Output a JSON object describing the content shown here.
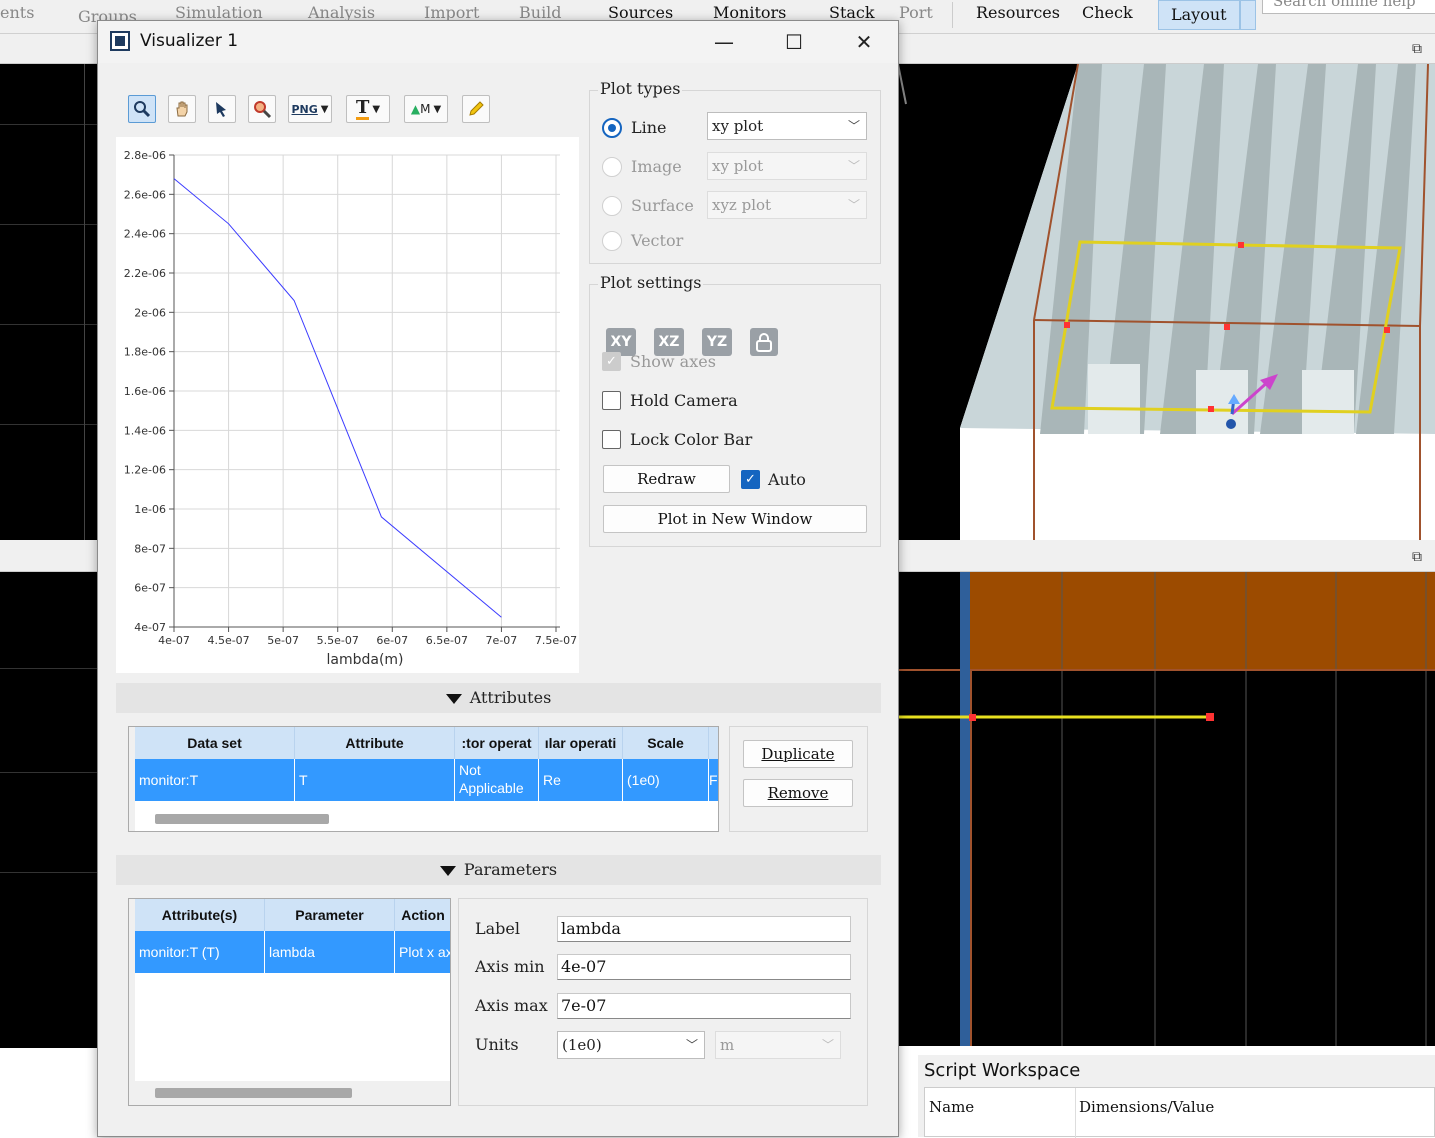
{
  "menu": {
    "items": [
      {
        "label": "ents",
        "dim": true
      },
      {
        "label": "Groups",
        "dim": true
      },
      {
        "label": "Simulation",
        "dim": true
      },
      {
        "label": "Analysis",
        "dim": true
      },
      {
        "label": "Import",
        "dim": true
      },
      {
        "label": "Build",
        "dim": true
      },
      {
        "label": "Sources",
        "dim": false
      },
      {
        "label": "Monitors",
        "dim": false
      },
      {
        "label": "Stack",
        "dim": false
      },
      {
        "label": "Port",
        "dim": true
      },
      {
        "label": "Resources",
        "dim": false
      },
      {
        "label": "Check",
        "dim": false
      },
      {
        "label": "Layout",
        "dim": false
      }
    ],
    "search_placeholder": "Search online help"
  },
  "script_workspace": {
    "title": "Script Workspace",
    "columns": [
      "Name",
      "Dimensions/Value"
    ]
  },
  "visualizer": {
    "title": "Visualizer 1",
    "window_controls": {
      "minimize": "—",
      "maximize": "☐",
      "close": "✕"
    },
    "toolbar": {
      "png_label": "PNG",
      "text_label": "T",
      "marker_label": "M"
    },
    "plot_types": {
      "title": "Plot types",
      "options": [
        {
          "label": "Line",
          "selected": true,
          "enabled": true,
          "combo": "xy plot"
        },
        {
          "label": "Image",
          "selected": false,
          "enabled": false,
          "combo": "xy plot"
        },
        {
          "label": "Surface",
          "selected": false,
          "enabled": false,
          "combo": "xyz plot"
        },
        {
          "label": "Vector",
          "selected": false,
          "enabled": false,
          "combo": ""
        }
      ]
    },
    "plot_settings": {
      "title": "Plot settings",
      "view_buttons": [
        "XY",
        "XZ",
        "YZ"
      ],
      "show_axes": {
        "label": "Show axes",
        "checked": true,
        "enabled": false
      },
      "hold_camera": {
        "label": "Hold Camera",
        "checked": false
      },
      "lock_color_bar": {
        "label": "Lock Color Bar",
        "checked": false
      },
      "redraw_label": "Redraw",
      "auto": {
        "label": "Auto",
        "checked": true
      },
      "plot_new_window_label": "Plot in New Window"
    },
    "attributes": {
      "header": "Attributes",
      "columns": [
        "Data set",
        "Attribute",
        ":tor operat",
        "ılar operati",
        "Scale"
      ],
      "rows": [
        {
          "data_set": "monitor:T",
          "attribute": "T",
          "vector_op": "Not Applicable",
          "scalar_op": "Re",
          "scale": "(1e0)",
          "extra": "F"
        }
      ],
      "duplicate_label": "Duplicate",
      "remove_label": "Remove"
    },
    "parameters": {
      "header": "Parameters",
      "columns": [
        "Attribute(s)",
        "Parameter",
        "Action"
      ],
      "rows": [
        {
          "attribute": "monitor:T (T)",
          "parameter": "lambda",
          "action": "Plot x ax"
        }
      ],
      "fields": {
        "label_label": "Label",
        "label_value": "lambda",
        "axis_min_label": "Axis min",
        "axis_min_value": "4e-07",
        "axis_max_label": "Axis max",
        "axis_max_value": "7e-07",
        "units_label": "Units",
        "units_value": "(1e0)",
        "units_unit": "m"
      }
    }
  },
  "chart_data": {
    "type": "line",
    "title": "",
    "xlabel": "lambda(m)",
    "ylabel": "",
    "xlim": [
      4e-07,
      7.5e-07
    ],
    "ylim": [
      4e-07,
      2.8e-06
    ],
    "xticks": [
      "4e-07",
      "4.5e-07",
      "5e-07",
      "5.5e-07",
      "6e-07",
      "6.5e-07",
      "7e-07",
      "7.5e-07"
    ],
    "yticks": [
      "4e-07",
      "6e-07",
      "8e-07",
      "1e-06",
      "1.2e-06",
      "1.4e-06",
      "1.6e-06",
      "1.8e-06",
      "2e-06",
      "2.2e-06",
      "2.4e-06",
      "2.6e-06",
      "2.8e-06"
    ],
    "grid": true,
    "series": [
      {
        "color": "#3b3bff",
        "x": [
          4e-07,
          4.5e-07,
          5.1e-07,
          5.9e-07,
          7e-07
        ],
        "y": [
          2.68e-06,
          2.45e-06,
          2.06e-06,
          9.6e-07,
          4.5e-07
        ]
      }
    ]
  }
}
